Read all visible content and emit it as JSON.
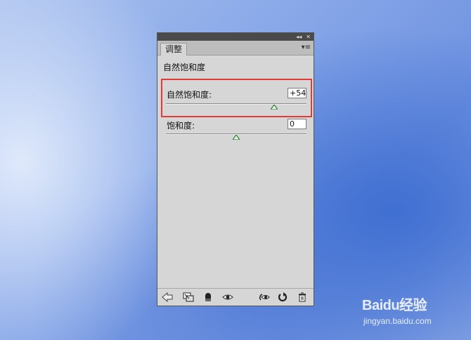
{
  "panel": {
    "tab_label": "调整",
    "heading": "自然饱和度",
    "controls": [
      {
        "label": "自然饱和度:",
        "value": "+54",
        "level_percent": 77
      },
      {
        "label": "饱和度:",
        "value": "0",
        "level_percent": 50
      }
    ],
    "bottom_icons": [
      "back-arrow-icon",
      "clip-layer-icon",
      "visibility-mask-icon",
      "eye-icon",
      "view-previous-icon",
      "reset-icon",
      "trash-icon"
    ]
  },
  "watermark": {
    "logo_text": "Baidu经验",
    "url": "jingyan.baidu.com"
  },
  "colors": {
    "highlight": "#e53935",
    "slider_thumb": "#2e7d32"
  }
}
